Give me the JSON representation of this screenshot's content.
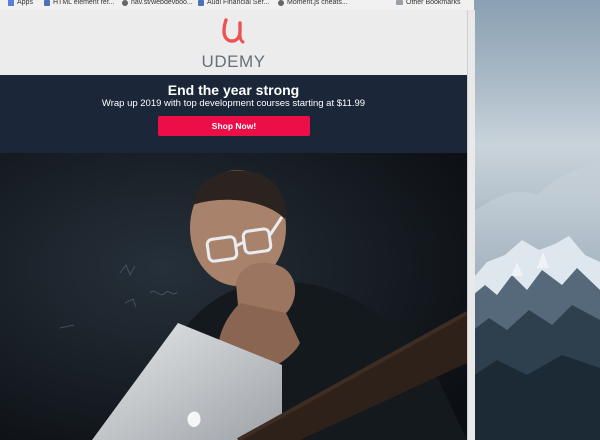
{
  "bookmarks_bar": {
    "items": [
      {
        "label": "Apps",
        "icon": "apps-grid-icon"
      },
      {
        "label": "HTML element ref...",
        "icon": "page-icon"
      },
      {
        "label": "nav.st/webdevboo...",
        "icon": "github-icon"
      },
      {
        "label": "Audi Financial Ser...",
        "icon": "page-icon"
      },
      {
        "label": "Moment.js cheats...",
        "icon": "github-icon"
      }
    ],
    "other_bookmarks": "Other Bookmarks"
  },
  "email": {
    "brand": {
      "logo_letter": "u",
      "name": "UDEMY",
      "logo_color": "#ec5252"
    },
    "promo": {
      "title": "End the year strong",
      "subtitle": "Wrap up 2019 with top development courses starting at $11.99",
      "button_label": "Shop Now!",
      "background_color": "#1b2738",
      "button_color": "#ec0f47"
    },
    "hero": {
      "image": "man-with-glasses-using-laptop-photo"
    }
  },
  "desktop": {
    "wallpaper": "snowy-mountains-wallpaper"
  }
}
